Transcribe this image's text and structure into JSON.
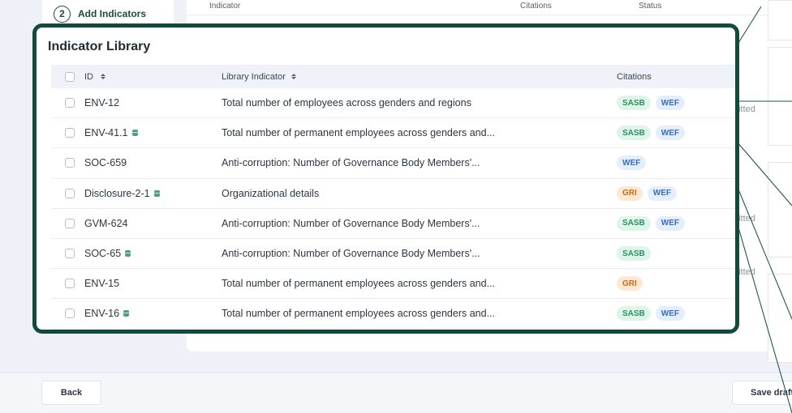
{
  "wizard": {
    "step_number": "2",
    "step_label": "Add Indicators"
  },
  "background_table": {
    "headers": {
      "indicator": "Indicator",
      "citations": "Citations",
      "status": "Status"
    },
    "status_fragments": [
      "nitted",
      "nitted",
      "nitted"
    ]
  },
  "library": {
    "title": "Indicator Library",
    "columns": {
      "id": "ID",
      "indicator": "Library Indicator",
      "citations": "Citations"
    },
    "rows": [
      {
        "id": "ENV-12",
        "has_stack_icon": false,
        "indicator": "Total number of employees across genders and regions",
        "citations": [
          "SASB",
          "WEF"
        ]
      },
      {
        "id": "ENV-41.1",
        "has_stack_icon": true,
        "indicator": "Total number of permanent employees across genders and...",
        "citations": [
          "SASB",
          "WEF"
        ]
      },
      {
        "id": "SOC-659",
        "has_stack_icon": false,
        "indicator": "Anti-corruption: Number of Governance Body Members'...",
        "citations": [
          "WEF"
        ]
      },
      {
        "id": "Disclosure-2-1",
        "has_stack_icon": true,
        "indicator": "Organizational details",
        "citations": [
          "GRI",
          "WEF"
        ]
      },
      {
        "id": "GVM-624",
        "has_stack_icon": false,
        "indicator": "Anti-corruption: Number of Governance Body Members'...",
        "citations": [
          "SASB",
          "WEF"
        ]
      },
      {
        "id": "SOC-65",
        "has_stack_icon": true,
        "indicator": "Anti-corruption: Number of Governance Body Members'...",
        "citations": [
          "SASB"
        ]
      },
      {
        "id": "ENV-15",
        "has_stack_icon": false,
        "indicator": "Total number of permanent employees across genders and...",
        "citations": [
          "GRI"
        ]
      },
      {
        "id": "ENV-16",
        "has_stack_icon": true,
        "indicator": "Total number of permanent employees across genders and...",
        "citations": [
          "SASB",
          "WEF"
        ]
      }
    ]
  },
  "footer": {
    "back_label": "Back",
    "save_label": "Save draft"
  },
  "colors": {
    "accent": "#14493e",
    "sasb": "#2f8e63",
    "wef": "#3a6bc0",
    "gri": "#c86a1a"
  }
}
